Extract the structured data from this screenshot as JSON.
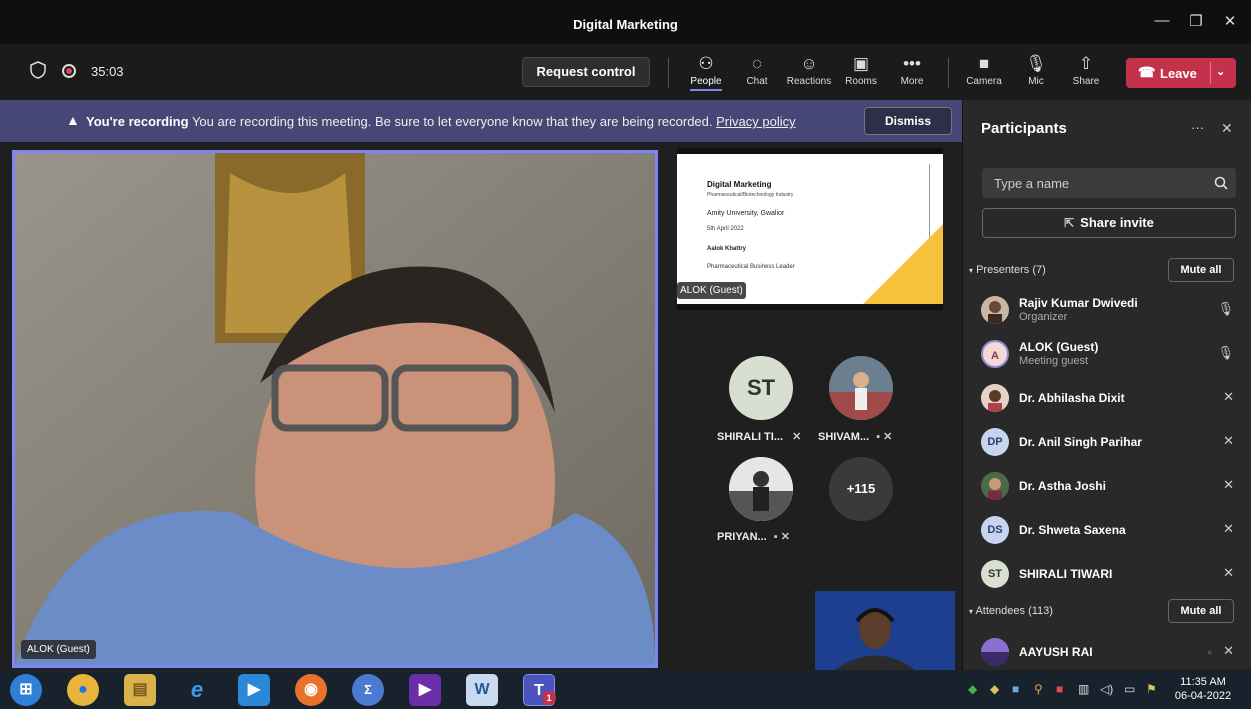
{
  "window": {
    "title": "Digital Marketing",
    "minimize": "—",
    "maximize": "❐",
    "close": "✕"
  },
  "header": {
    "timer": "35:03",
    "request_control": "Request control",
    "tools": [
      {
        "icon": "people-icon",
        "glyph": "⚇",
        "label": "People",
        "active": true
      },
      {
        "icon": "chat-icon",
        "glyph": "◌",
        "label": "Chat"
      },
      {
        "icon": "reactions-icon",
        "glyph": "☺",
        "label": "Reactions"
      },
      {
        "icon": "rooms-icon",
        "glyph": "▣",
        "label": "Rooms"
      },
      {
        "icon": "more-icon",
        "glyph": "•••",
        "label": "More"
      }
    ],
    "devices": [
      {
        "icon": "camera-icon",
        "glyph": "■",
        "label": "Camera"
      },
      {
        "icon": "mic-icon",
        "glyph": "🎙",
        "label": "Mic"
      },
      {
        "icon": "share-icon",
        "glyph": "⇧",
        "label": "Share"
      }
    ],
    "leave": "Leave",
    "leave_color": "#c4314b"
  },
  "banner": {
    "bold": "You're recording",
    "text": "You are recording this meeting. Be sure to let everyone know that they are being recorded.",
    "link": "Privacy policy",
    "dismiss": "Dismiss"
  },
  "main_video": {
    "name": "ALOK (Guest)"
  },
  "slide": {
    "name": "ALOK (Guest)",
    "title": "Digital Marketing",
    "subtitle": "Pharmaceutical/Biotechnology Industry",
    "lines": [
      "Amity University, Gwalior",
      "5th April 2022",
      "Aalok Khattry",
      "Pharmaceutical Business Leader"
    ]
  },
  "tiles": [
    {
      "initials": "ST",
      "label": "SHIRALI TI...",
      "icons": "🎙̸"
    },
    {
      "initials": "",
      "label": "SHIVAM...",
      "icons": "▣ 🎙̸"
    },
    {
      "initials": "",
      "label": "PRIYAN...",
      "icons": "▣ 🎙̸"
    },
    {
      "initials": "+115",
      "label": ""
    }
  ],
  "pane": {
    "title": "Participants",
    "more": "···",
    "close": "✕",
    "search_placeholder": "Type a name",
    "share_invite": "Share invite",
    "presenters_header": "Presenters (7)",
    "attendees_header": "Attendees (113)",
    "mute_all": "Mute all",
    "presenters": [
      {
        "name": "Rajiv Kumar Dwivedi",
        "role": "Organizer",
        "avatar": "",
        "avatar_color": "#7a5c45",
        "mic": "on"
      },
      {
        "name": "ALOK (Guest)",
        "role": "Meeting guest",
        "avatar": "A",
        "avatar_color": "#f5d7d8",
        "mic": "on"
      },
      {
        "name": "Dr. Abhilasha Dixit",
        "role": "",
        "avatar": "",
        "avatar_color": "#b77b6a",
        "mic": "off"
      },
      {
        "name": "Dr. Anil Singh Parihar",
        "role": "",
        "avatar": "DP",
        "avatar_color": "#c7d4ef",
        "mic": "off"
      },
      {
        "name": "Dr. Astha Joshi",
        "role": "",
        "avatar": "",
        "avatar_color": "#6b5a4a",
        "mic": "off"
      },
      {
        "name": "Dr. Shweta Saxena",
        "role": "",
        "avatar": "DS",
        "avatar_color": "#c7d4ef",
        "mic": "off"
      },
      {
        "name": "SHIRALI TIWARI",
        "role": "",
        "avatar": "ST",
        "avatar_color": "#d8ded0",
        "mic": "off"
      }
    ],
    "attendees": [
      {
        "name": "AAYUSH RAI",
        "role": "",
        "avatar": "",
        "avatar_color": "#6b4fa8",
        "mic": "off"
      }
    ]
  },
  "taskbar": {
    "time": "11:35 AM",
    "date": "06-04-2022",
    "teams_badge": "1"
  }
}
